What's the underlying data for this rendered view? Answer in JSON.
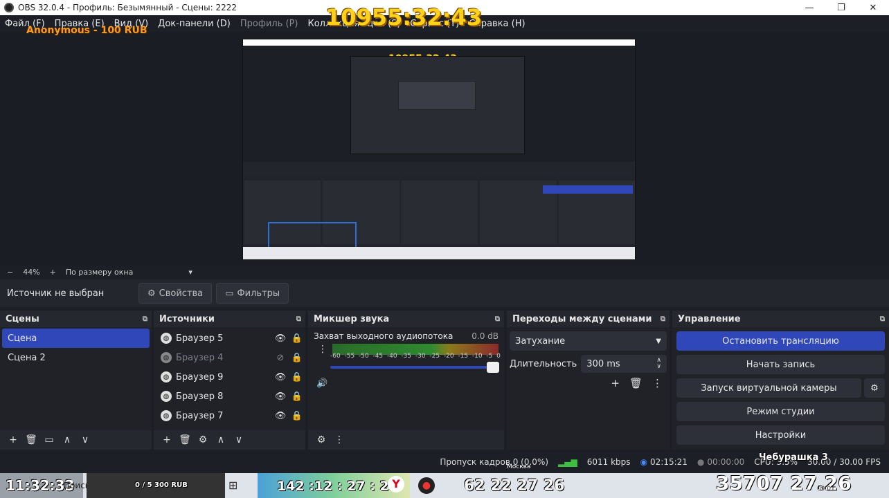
{
  "window": {
    "title": "OBS 32.0.4 - Профиль: Безымянный - Сцены: 2222",
    "minimize": "—",
    "maximize": "❐",
    "close": "✕"
  },
  "menu": [
    "Файл (F)",
    "Правка (E)",
    "Вид (V)",
    "Док-панели (D)",
    "Профиль (P)",
    "Коллекция сцен (S)",
    "Сервис (T)",
    "Справка (H)"
  ],
  "overlay": {
    "timer": "10955:32:43",
    "donation": "Anonymous - 100 RUB",
    "preview_timer": "10955:32:43"
  },
  "zoom": {
    "minus": "−",
    "level": "44%",
    "plus": "+",
    "fit": "По размеру окна",
    "caret": "▾"
  },
  "source_bar": {
    "label": "Источник не выбран",
    "properties": "Свойства",
    "filters": "Фильтры"
  },
  "scenes": {
    "title": "Сцены",
    "items": [
      "Сцена",
      "Сцена 2"
    ]
  },
  "sources": {
    "title": "Источники",
    "items": [
      {
        "name": "Браузер 5",
        "visible": true
      },
      {
        "name": "Браузер 4",
        "visible": false
      },
      {
        "name": "Браузер 9",
        "visible": true
      },
      {
        "name": "Браузер 8",
        "visible": true
      },
      {
        "name": "Браузер 7",
        "visible": true
      }
    ]
  },
  "mixer": {
    "title": "Микшер звука",
    "channel": "Захват выходного аудиопотока",
    "db": "0.0 dB",
    "ticks": [
      "-60",
      "-55",
      "-50",
      "-45",
      "-40",
      "-35",
      "-30",
      "-25",
      "-20",
      "-15",
      "-10",
      "-5",
      "0"
    ]
  },
  "transitions": {
    "title": "Переходы между сценами",
    "selected": "Затухание",
    "duration_label": "Длительность",
    "duration": "300 ms"
  },
  "controls": {
    "title": "Управление",
    "buttons": [
      "Остановить трансляцию",
      "Начать запись",
      "Запуск виртуальной камеры",
      "Режим студии",
      "Настройки"
    ]
  },
  "status": {
    "dropped": "Пропуск кадров 0 (0.0%)",
    "bitrate": "6011 kbps",
    "stream_time": "02:15:21",
    "rec_time": "00:00:00",
    "cpu": "CPU: 3.5%",
    "fps": "30.00 / 30.00 FPS"
  },
  "taskbar": {
    "clock": "11:32:33",
    "search": "Поиск",
    "donate_progress": "0 / 5 300 RUB",
    "counter1": "142 :12 : 27 : 25",
    "counter2": "62 22 27 26",
    "counter3": "35707 27.26",
    "city": "Москва",
    "nickname": "Чебурашка 3",
    "date": "09.01"
  },
  "colors": {
    "accent": "#2f47b8",
    "timer": "#ffd21a",
    "donation": "#ff9b1a"
  }
}
